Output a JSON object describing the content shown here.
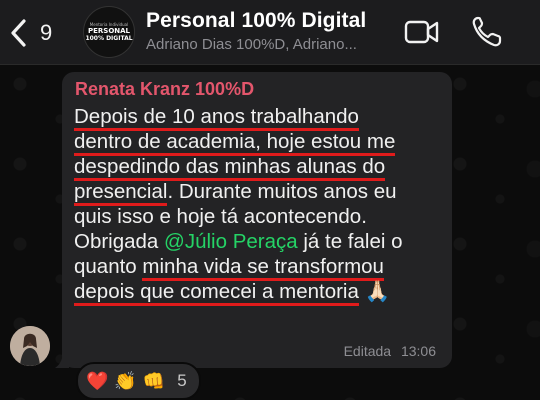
{
  "header": {
    "back_count": "9",
    "title": "Personal 100% Digital",
    "subtitle": "Adriano Dias 100%D, Adriano...",
    "avatar_lines": [
      "Mentoria Individual",
      "PERSONAL",
      "100% DIGITAL"
    ],
    "icons": {
      "back": "chevron-left-icon",
      "video": "video-camera-icon",
      "phone": "phone-icon"
    }
  },
  "message": {
    "sender": "Renata Kranz 100%D",
    "lines": [
      "Depois de 10 anos trabalhando",
      "dentro de academia, hoje estou me",
      "despedindo das minhas alunas do",
      "presencial",
      ". Durante muitos anos eu",
      "quis isso e hoje tá acontecendo.",
      "Obrigada ",
      "@Júlio Peraça",
      " já te falei o",
      "quanto ",
      "minha vida se transformou",
      "depois que comecei a mentoria",
      " 🙏🏻"
    ],
    "edited_label": "Editada",
    "time": "13:06"
  },
  "reactions": {
    "emojis": [
      "❤️",
      "👏",
      "👊"
    ],
    "count": "5"
  },
  "colors": {
    "header_bg": "#1c1c1e",
    "bubble_bg": "#232325",
    "sender_name": "#e3566c",
    "mention": "#25d366",
    "underline": "#e01b1b",
    "meta_text": "#8e8e93"
  }
}
